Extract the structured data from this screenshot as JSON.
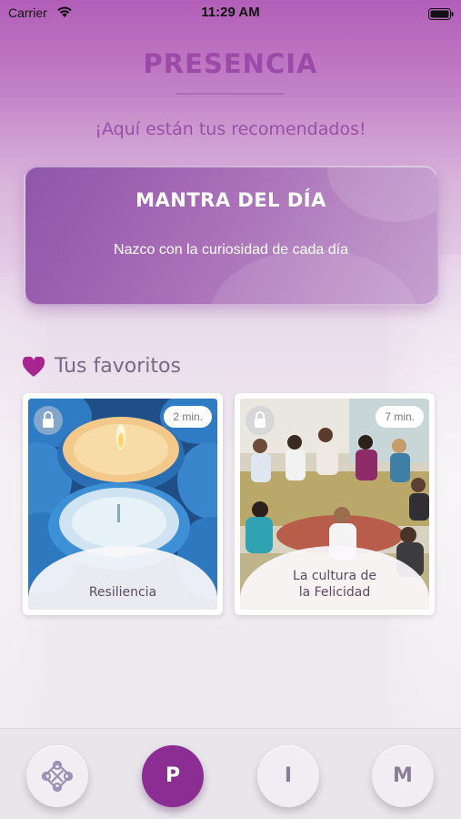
{
  "status_bar": {
    "carrier": "Carrier",
    "time": "11:29 AM"
  },
  "header": {
    "title": "PRESENCIA",
    "subtitle": "¡Aquí están tus recomendados!"
  },
  "mantra": {
    "title": "MANTRA DEL DÍA",
    "text": "Nazco con la curiosidad de cada día"
  },
  "favorites": {
    "title": "Tus favoritos",
    "items": [
      {
        "label": "Resiliencia",
        "duration": "2 min.",
        "locked": true
      },
      {
        "label": "La cultura de\nla Felicidad",
        "duration": "7 min.",
        "locked": true
      }
    ]
  },
  "tab_bar": {
    "tabs": [
      {
        "icon": "knot-icon",
        "label": ""
      },
      {
        "label": "P",
        "active": true
      },
      {
        "label": "I"
      },
      {
        "label": "M"
      }
    ]
  },
  "colors": {
    "accent": "#8b2d92",
    "title": "#9b4aa8",
    "heart": "#a8248f"
  }
}
